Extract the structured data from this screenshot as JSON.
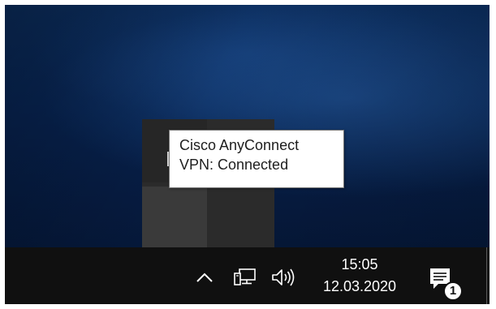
{
  "tooltip": {
    "line1": "Cisco AnyConnect",
    "line2": "VPN: Connected"
  },
  "tray_overflow": {
    "items": [
      {
        "icon": "cisco-anyconnect-vpn-icon",
        "state": "connected"
      }
    ]
  },
  "taskbar": {
    "icons": [
      "chevron-up-icon",
      "network-icon",
      "volume-icon",
      "notification-center-icon"
    ],
    "clock": {
      "time": "15:05",
      "date": "12.03.2020"
    },
    "notifications": {
      "count": "1"
    }
  },
  "colors": {
    "taskbar": "#101010",
    "flyout": "#2b2b2b",
    "desktop": "#072350",
    "lock_badge": "#f2b705"
  }
}
